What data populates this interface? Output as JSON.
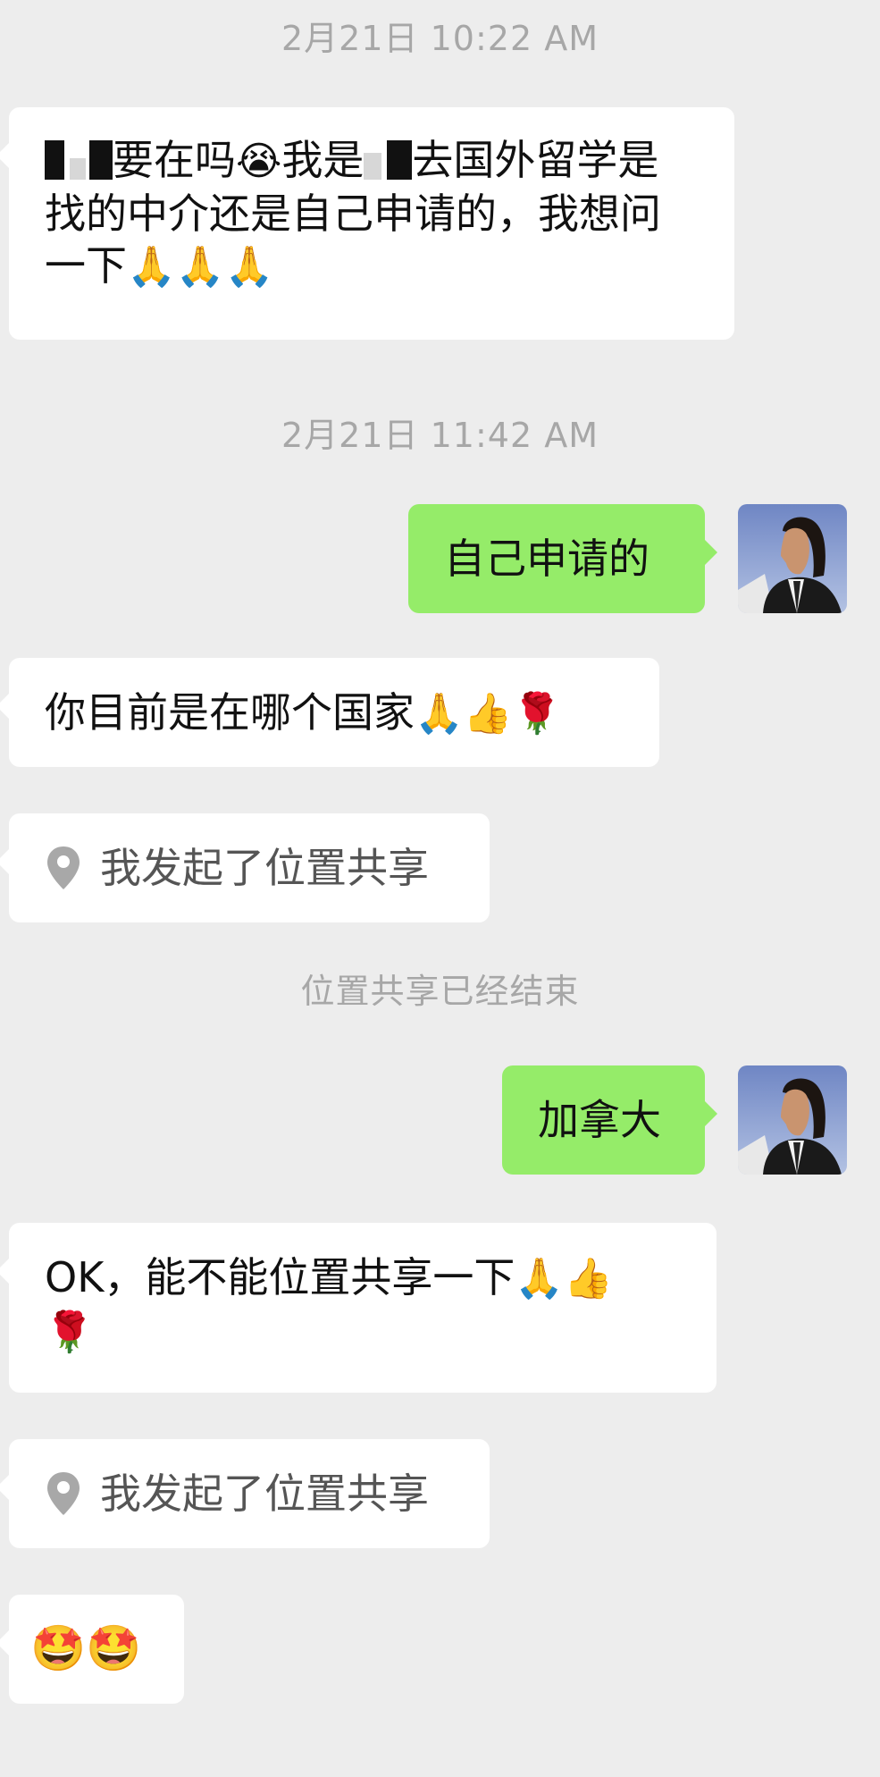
{
  "messages": [
    {
      "type": "timestamp",
      "text": "2月21日 10:22 AM"
    },
    {
      "type": "incoming",
      "text_a": "要在吗",
      "emoji_a": "😭",
      "text_b": "我是",
      "text_c": "去国外留学是找的中介还是自己申请的，我想问一下",
      "emoji_b": "🙏🙏🙏"
    },
    {
      "type": "timestamp",
      "text": "2月21日 11:42 AM"
    },
    {
      "type": "outgoing",
      "text": "自己申请的"
    },
    {
      "type": "incoming",
      "text": "你目前是在哪个国家",
      "emoji": "🙏👍🌹"
    },
    {
      "type": "location",
      "text": "我发起了位置共享"
    },
    {
      "type": "system",
      "text": "位置共享已经结束"
    },
    {
      "type": "outgoing",
      "text": "加拿大"
    },
    {
      "type": "incoming",
      "text": "OK，能不能位置共享一下",
      "emoji_a": "🙏👍",
      "emoji_b": "🌹"
    },
    {
      "type": "location",
      "text": "我发起了位置共享"
    },
    {
      "type": "incoming",
      "emoji": "🤩🤩"
    }
  ],
  "colors": {
    "background": "#ededed",
    "incoming_bubble": "#ffffff",
    "outgoing_bubble": "#95ec69",
    "timestamp_text": "#a7a7a7",
    "location_icon": "#a8a8a8"
  },
  "icons": {
    "location": "location-pin-icon",
    "avatar": "user-avatar"
  }
}
